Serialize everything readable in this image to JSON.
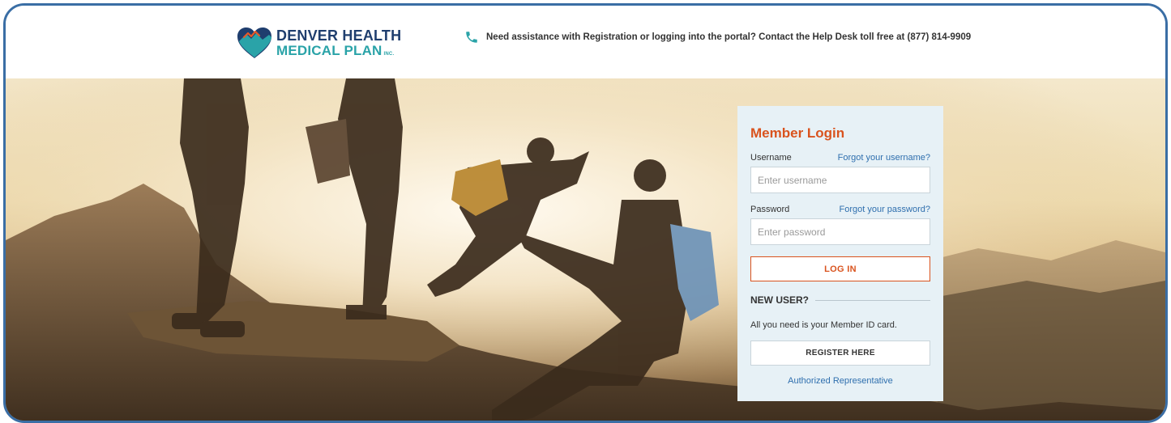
{
  "brand": {
    "name_line1": "DENVER HEALTH",
    "name_line2": "MEDICAL PLAN",
    "name_suffix": "INC.",
    "colors": {
      "navy": "#1f3e6e",
      "teal": "#2aa3a8",
      "orange": "#d9531e",
      "link": "#2f6fae",
      "frame": "#3a6ea5"
    }
  },
  "header": {
    "help_icon": "phone-icon",
    "help_text": "Need assistance with Registration or logging into the portal? Contact the Help Desk toll free at (877) 814-9909"
  },
  "hero": {
    "image": "family-hiking-sunset-photo"
  },
  "login": {
    "title": "Member Login",
    "username_label": "Username",
    "forgot_username": "Forgot your username?",
    "username_placeholder": "Enter username",
    "username_value": "",
    "password_label": "Password",
    "forgot_password": "Forgot your password?",
    "password_placeholder": "Enter password",
    "password_value": "",
    "login_button": "LOG IN",
    "new_user_title": "NEW USER?",
    "new_user_desc": "All you need is your Member ID card.",
    "register_button": "REGISTER HERE",
    "authorized_rep": "Authorized Representative"
  }
}
